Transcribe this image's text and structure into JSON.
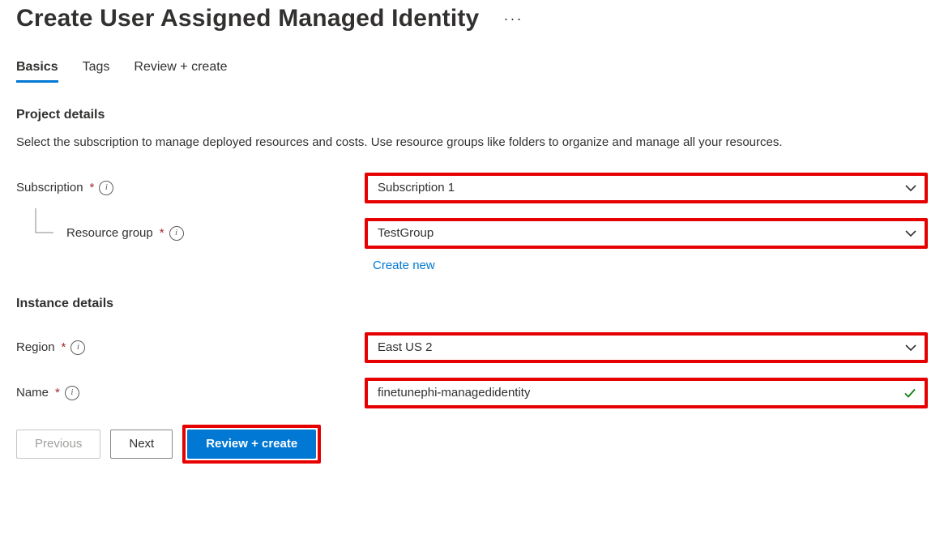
{
  "page": {
    "title": "Create User Assigned Managed Identity"
  },
  "tabs": {
    "basics": "Basics",
    "tags": "Tags",
    "review_create": "Review + create"
  },
  "sections": {
    "project_details": {
      "heading": "Project details",
      "description": "Select the subscription to manage deployed resources and costs. Use resource groups like folders to organize and manage all your resources."
    },
    "instance_details": {
      "heading": "Instance details"
    }
  },
  "fields": {
    "subscription": {
      "label": "Subscription",
      "value": "Subscription 1"
    },
    "resource_group": {
      "label": "Resource group",
      "value": "TestGroup",
      "create_new_link": "Create new"
    },
    "region": {
      "label": "Region",
      "value": "East US 2"
    },
    "name": {
      "label": "Name",
      "value": "finetunephi-managedidentity"
    }
  },
  "footer": {
    "previous": "Previous",
    "next": "Next",
    "review_create": "Review + create"
  }
}
